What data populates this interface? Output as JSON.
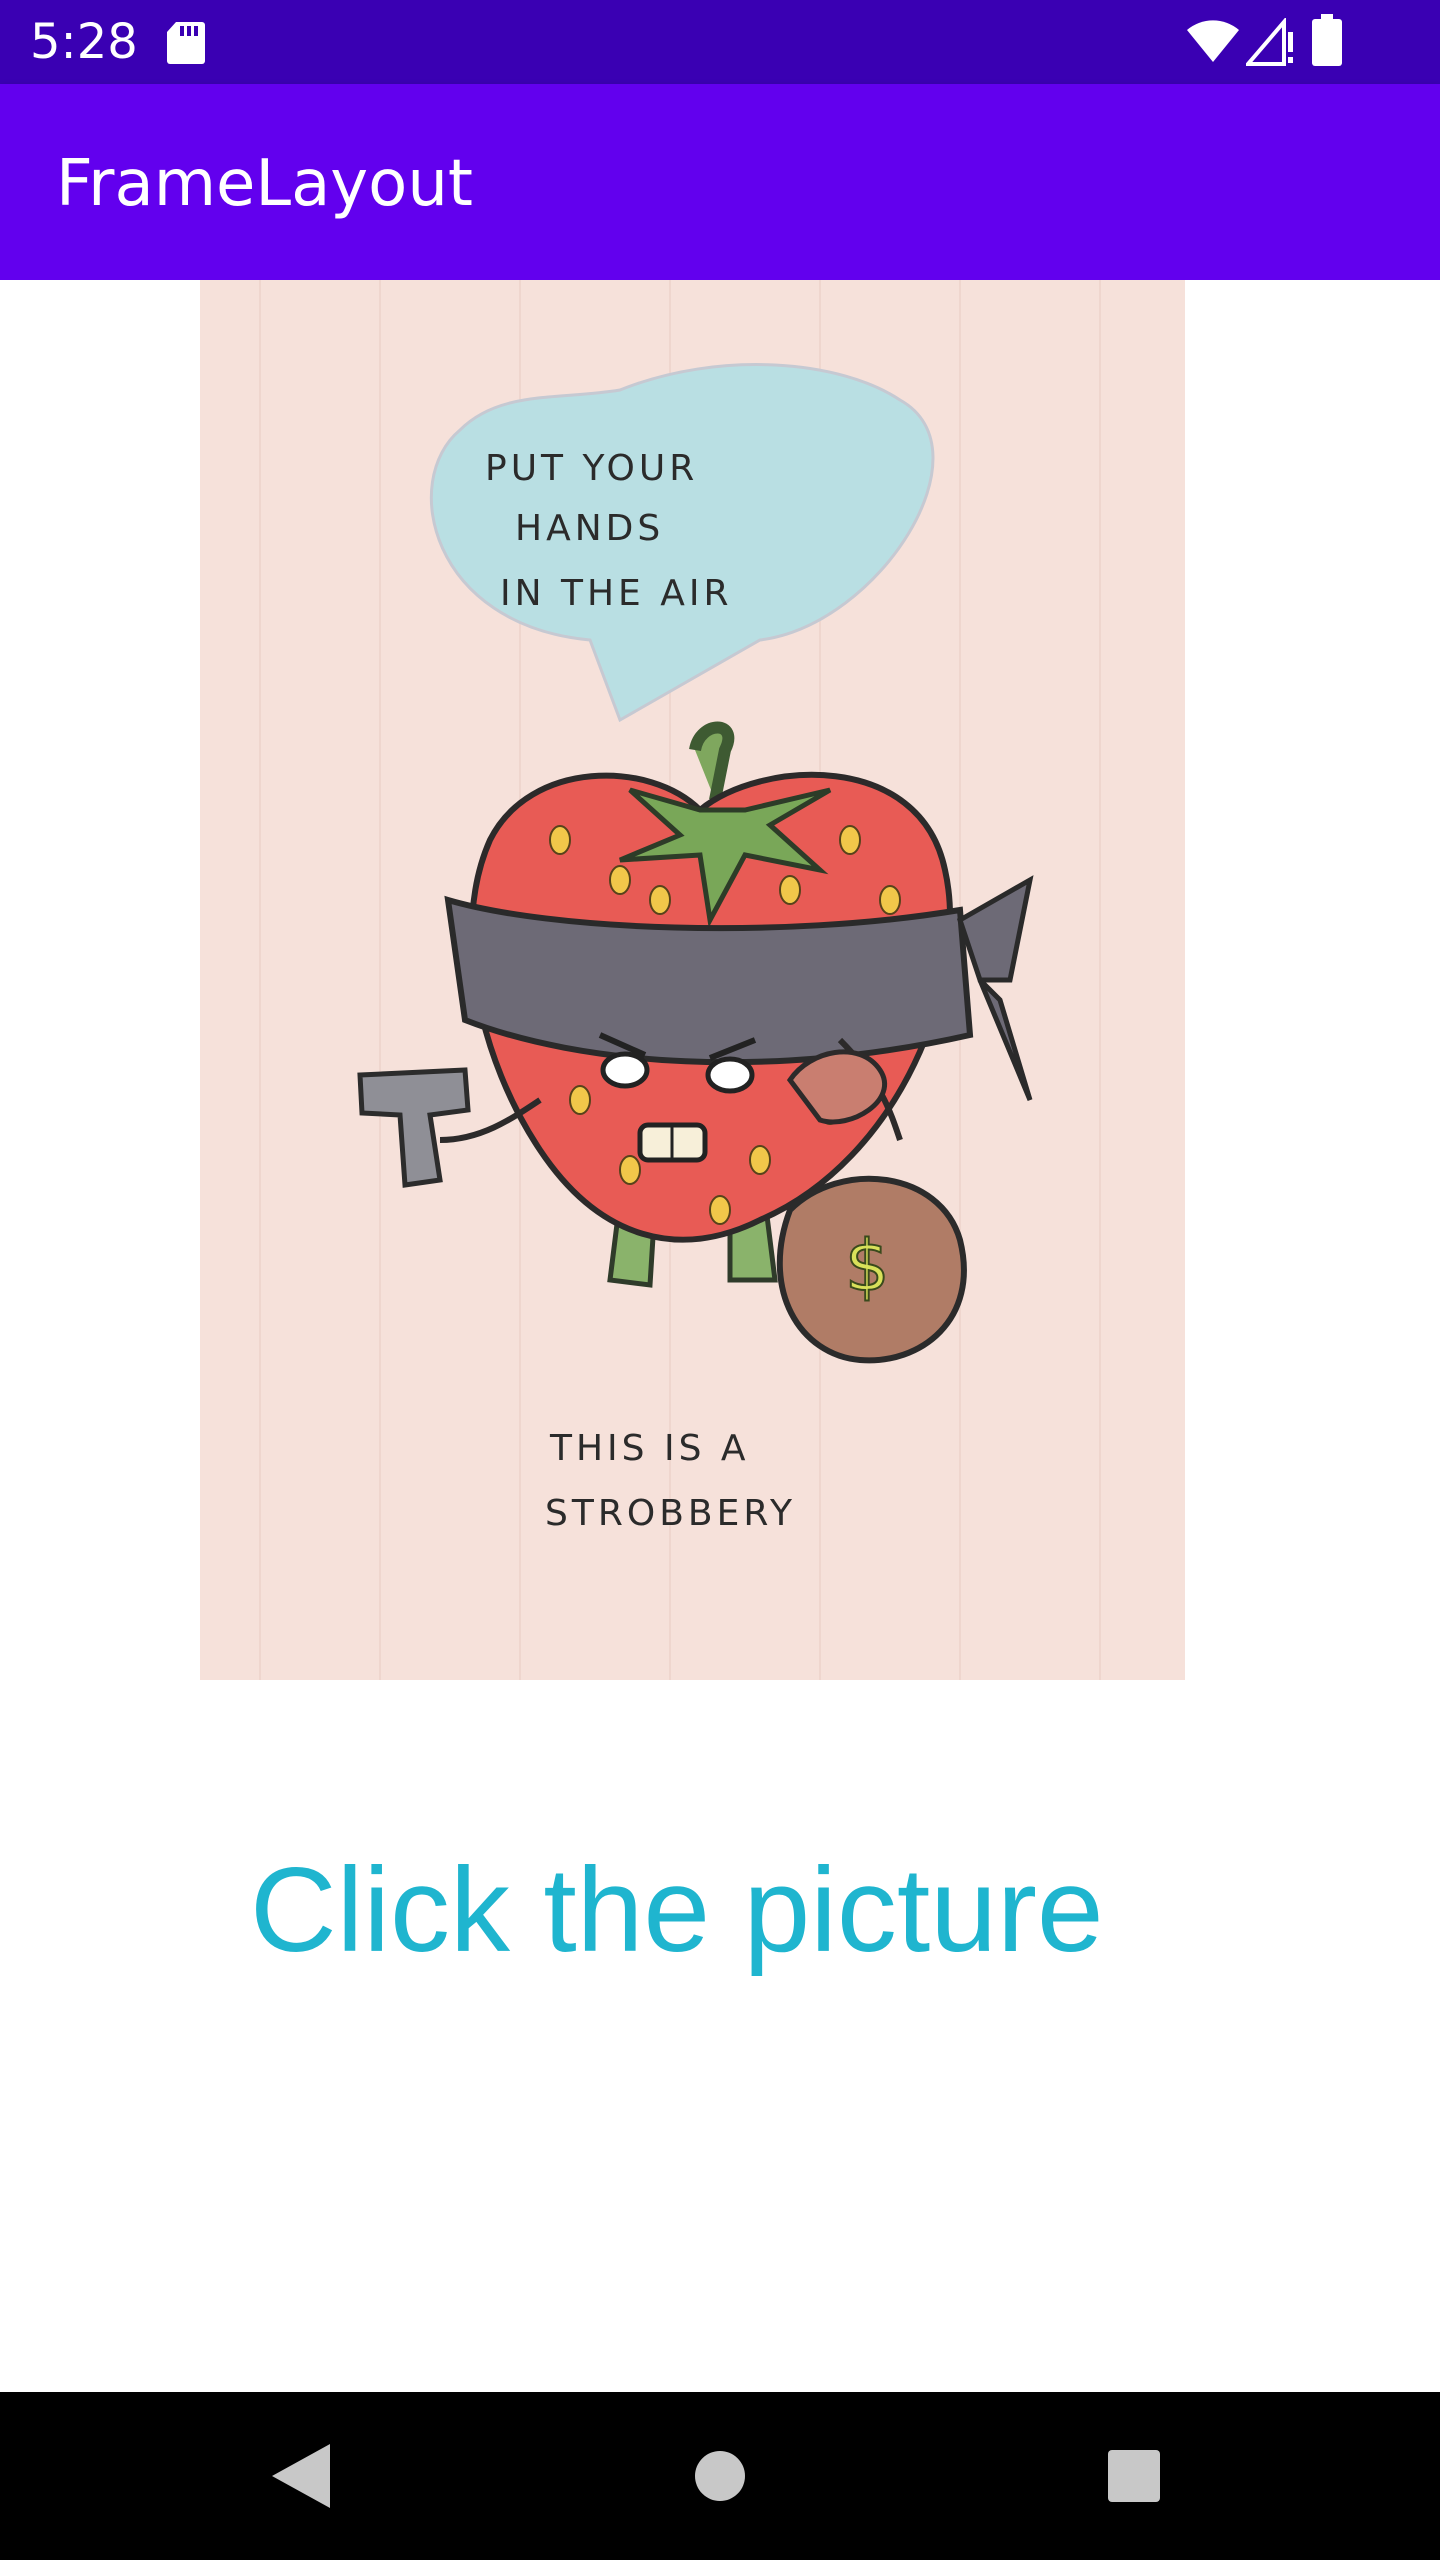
{
  "status_bar": {
    "time": "5:28",
    "icons": [
      "sd-card-icon",
      "wifi-icon",
      "signal-icon",
      "battery-icon"
    ],
    "background": "#3a00b3"
  },
  "app_bar": {
    "title": "FrameLayout",
    "background": "#6200ee"
  },
  "picture": {
    "speech_bubble_lines": [
      "PUT YOUR",
      "HANDS",
      "IN THE AIR"
    ],
    "bottom_text_lines": [
      "THIS IS A",
      "STROBBERY"
    ],
    "money_symbol": "$"
  },
  "caption": {
    "text": "Click the picture",
    "color": "#1fb5cf"
  },
  "nav_bar": {
    "icons": [
      "back-icon",
      "home-icon",
      "recents-icon"
    ]
  }
}
